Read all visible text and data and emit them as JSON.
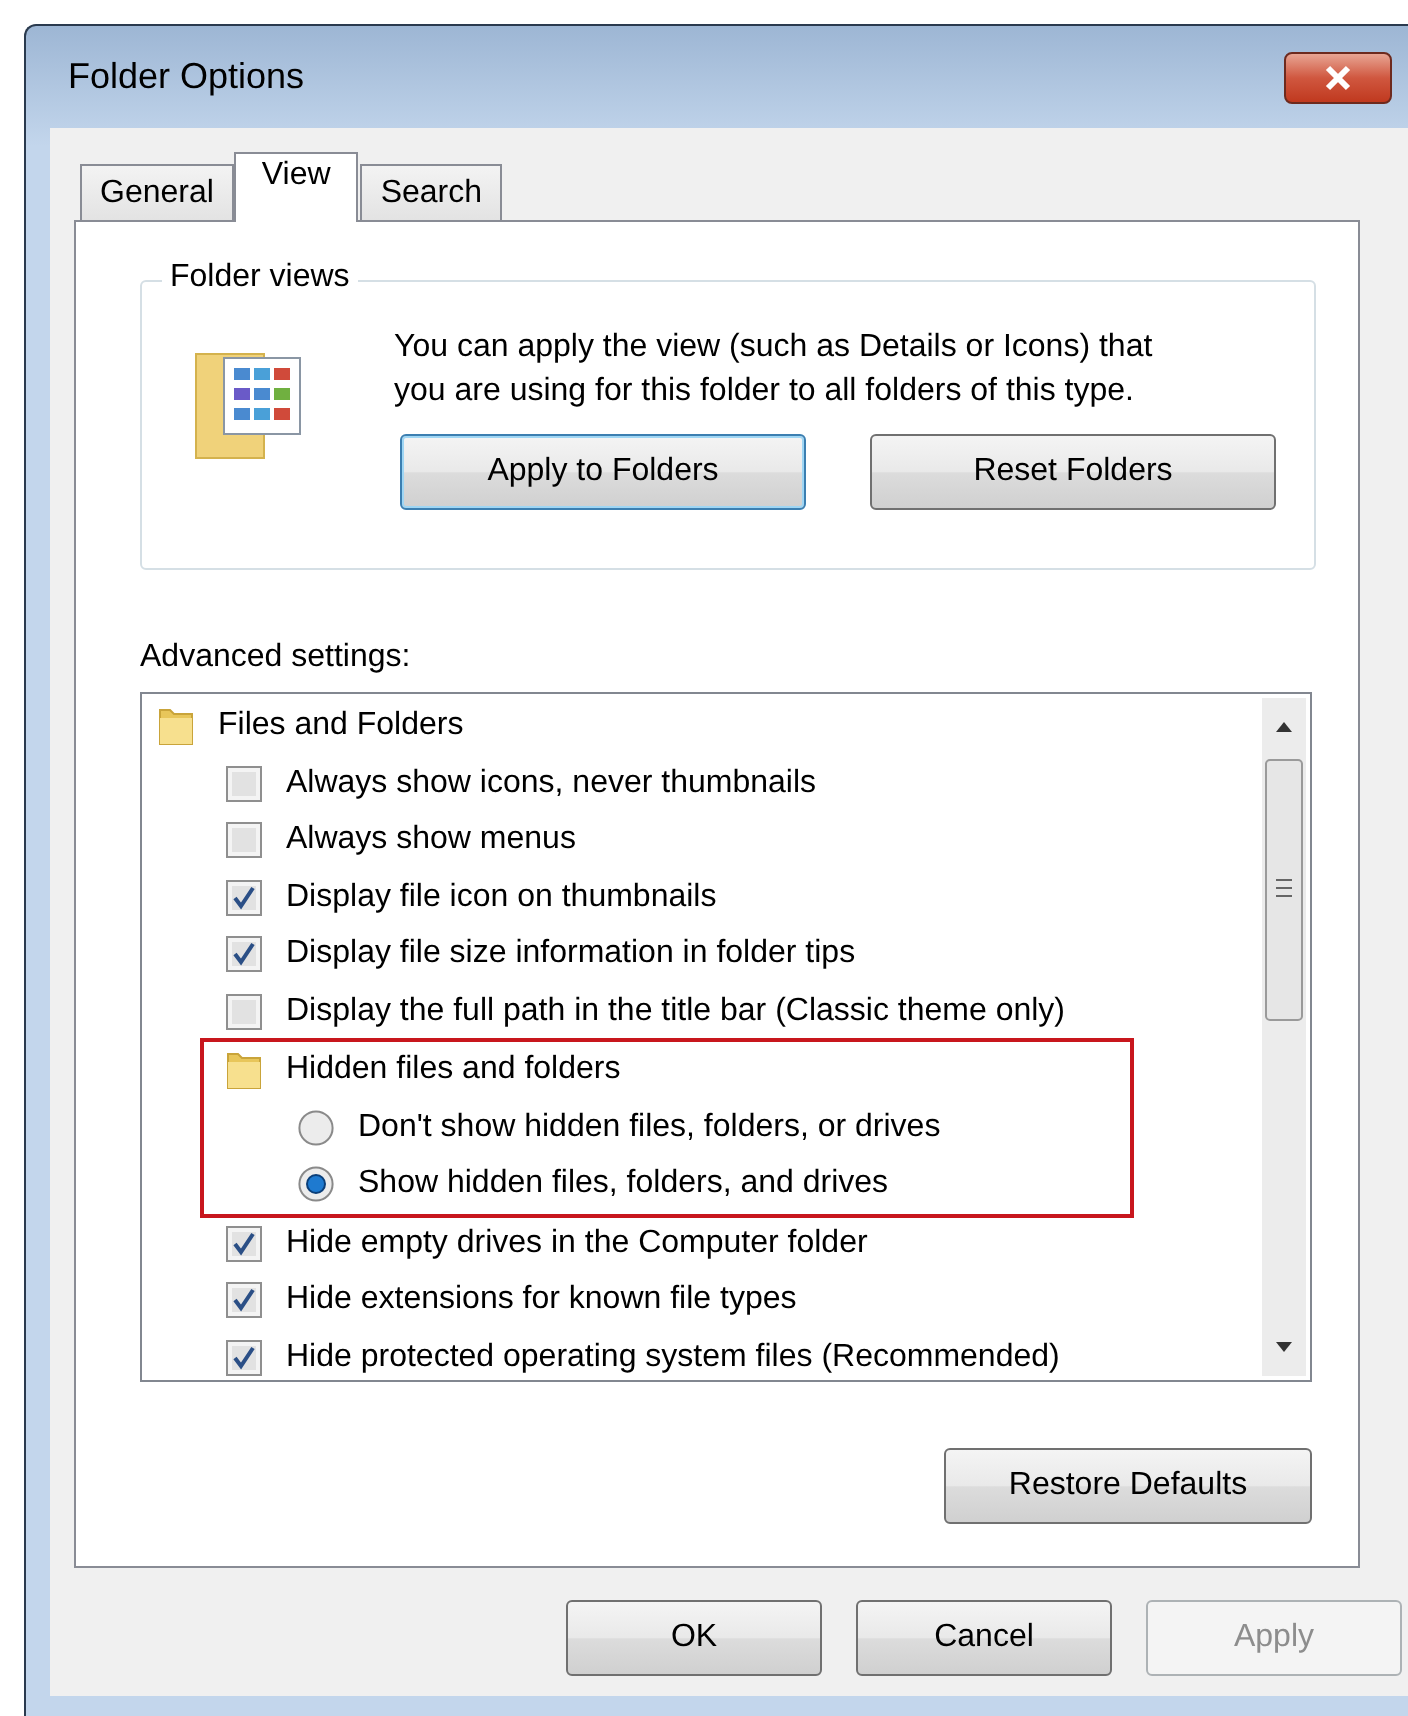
{
  "window": {
    "title": "Folder Options"
  },
  "tabs": [
    {
      "label": "General",
      "selected": false
    },
    {
      "label": "View",
      "selected": true
    },
    {
      "label": "Search",
      "selected": false
    }
  ],
  "folder_views": {
    "title": "Folder views",
    "description": "You can apply the view (such as Details or Icons) that\nyou are using for this folder to all folders of this type.",
    "buttons": [
      {
        "label": "Apply to Folders",
        "focused": true
      },
      {
        "label": "Reset Folders",
        "focused": false
      }
    ]
  },
  "advanced": {
    "label": "Advanced settings:",
    "items": [
      {
        "kind": "group",
        "label": "Files and Folders",
        "highlighted": false,
        "children": [
          {
            "kind": "checkbox",
            "label": "Always show icons, never thumbnails",
            "checked": false
          },
          {
            "kind": "checkbox",
            "label": "Always show menus",
            "checked": false
          },
          {
            "kind": "checkbox",
            "label": "Display file icon on thumbnails",
            "checked": true
          },
          {
            "kind": "checkbox",
            "label": "Display file size information in folder tips",
            "checked": true
          },
          {
            "kind": "checkbox",
            "label": "Display the full path in the title bar (Classic theme only)",
            "checked": false
          },
          {
            "kind": "group",
            "label": "Hidden files and folders",
            "highlighted": true,
            "children": [
              {
                "kind": "radio",
                "label": "Don't show hidden files, folders, or drives",
                "selected": false
              },
              {
                "kind": "radio",
                "label": "Show hidden files, folders, and drives",
                "selected": true
              }
            ]
          },
          {
            "kind": "checkbox",
            "label": "Hide empty drives in the Computer folder",
            "checked": true
          },
          {
            "kind": "checkbox",
            "label": "Hide extensions for known file types",
            "checked": true
          },
          {
            "kind": "checkbox",
            "label": "Hide protected operating system files (Recommended)",
            "checked": true
          }
        ]
      }
    ],
    "restore_button": "Restore Defaults"
  },
  "buttons": [
    {
      "label": "OK",
      "disabled": false
    },
    {
      "label": "Cancel",
      "disabled": false
    },
    {
      "label": "Apply",
      "disabled": true
    }
  ]
}
